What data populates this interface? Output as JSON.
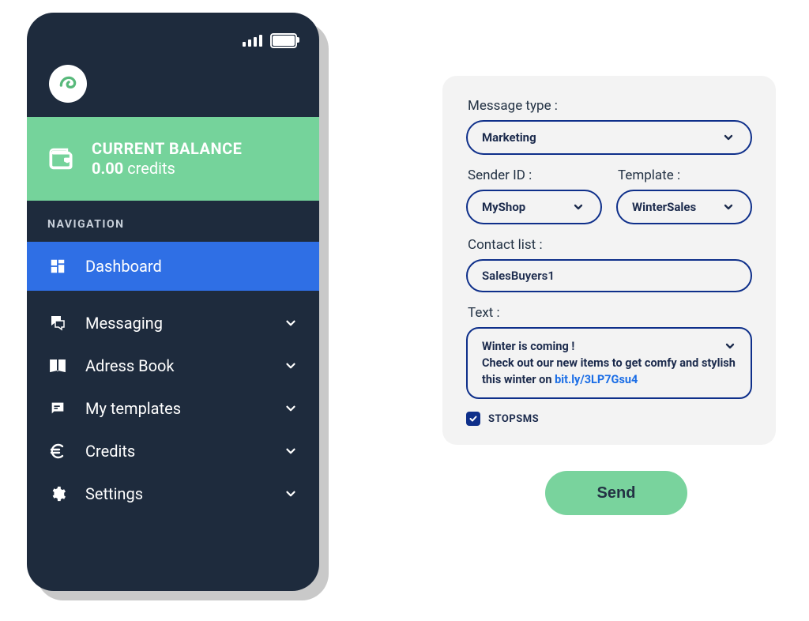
{
  "phone": {
    "balance": {
      "title": "CURRENT BALANCE",
      "amount": "0.00",
      "unit": "credits"
    },
    "navigation_header": "NAVIGATION",
    "items": [
      {
        "label": "Dashboard",
        "icon": "dashboard",
        "active": true,
        "expandable": false
      },
      {
        "label": "Messaging",
        "icon": "messaging",
        "active": false,
        "expandable": true
      },
      {
        "label": "Adress Book",
        "icon": "address-book",
        "active": false,
        "expandable": true
      },
      {
        "label": "My templates",
        "icon": "templates",
        "active": false,
        "expandable": true
      },
      {
        "label": "Credits",
        "icon": "euro",
        "active": false,
        "expandable": true
      },
      {
        "label": "Settings",
        "icon": "gear",
        "active": false,
        "expandable": true
      }
    ]
  },
  "form": {
    "message_type": {
      "label": "Message type :",
      "value": "Marketing"
    },
    "sender_id": {
      "label": "Sender ID :",
      "value": "MyShop"
    },
    "template": {
      "label": "Template :",
      "value": "WinterSales"
    },
    "contact_list": {
      "label": "Contact list :",
      "value": "SalesBuyers1"
    },
    "text": {
      "label": "Text :",
      "line1": "Winter is coming !",
      "line2": "Check out our new items to get comfy and stylish this winter on",
      "link": "bit.ly/3LP7Gsu4"
    },
    "stopsms": {
      "label": "STOPSMS",
      "checked": true
    },
    "send_label": "Send"
  }
}
